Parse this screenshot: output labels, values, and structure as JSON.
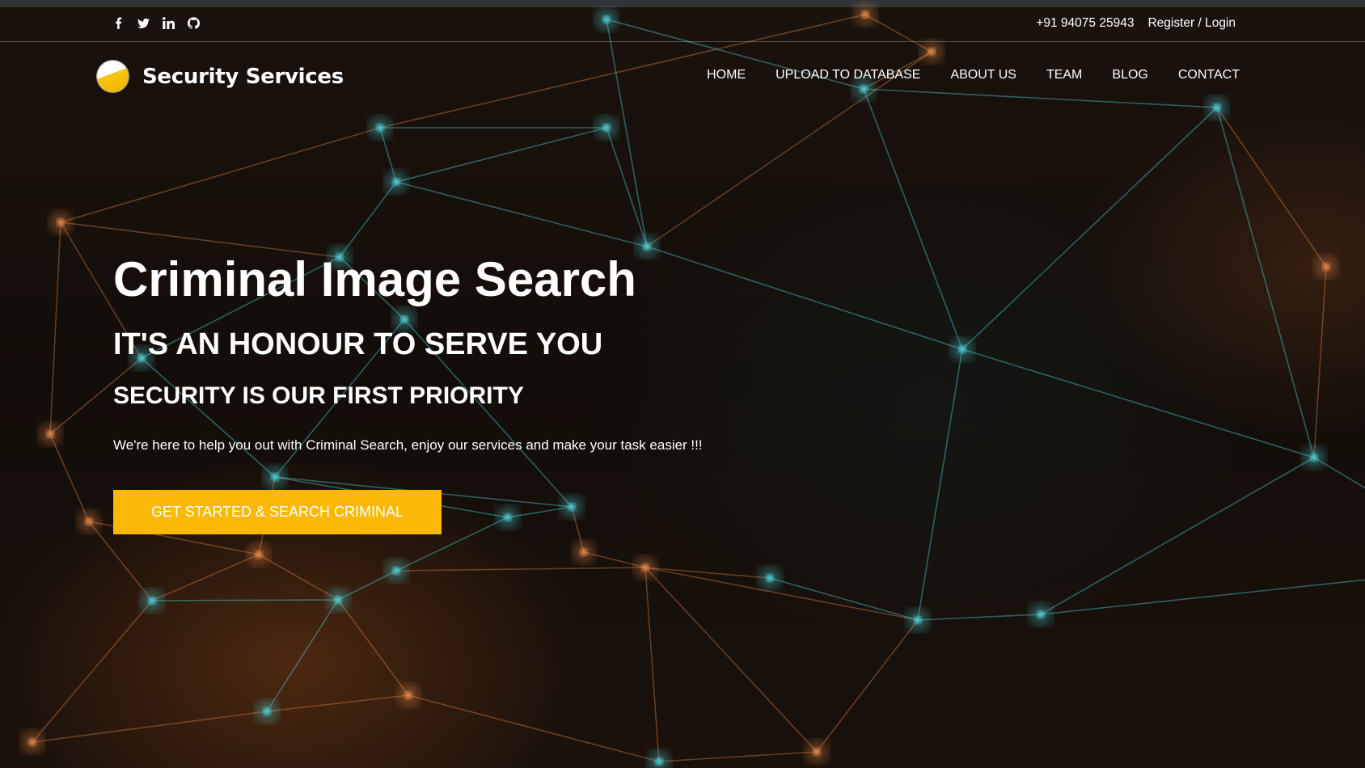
{
  "topbar": {
    "social_icons": [
      "facebook-icon",
      "twitter-icon",
      "linkedin-icon",
      "github-icon"
    ],
    "phone": "+91 94075 25943",
    "auth_link": "Register / Login"
  },
  "brand": {
    "name": "Security Services",
    "logo_colors": {
      "top": "#ffffff",
      "bottom": "#f0b500"
    }
  },
  "nav": {
    "items": [
      "HOME",
      "UPLOAD TO DATABASE",
      "ABOUT US",
      "TEAM",
      "BLOG",
      "CONTACT"
    ]
  },
  "hero": {
    "title": "Criminal Image Search",
    "subtitle": "IT'S AN HONOUR TO SERVE YOU",
    "tagline": "SECURITY IS OUR FIRST PRIORITY",
    "description": "We're here to help you out with Criminal Search, enjoy our services and make your task easier !!!",
    "cta_label": "GET STARTED & SEARCH CRIMINAL"
  },
  "colors": {
    "accent": "#fbb808",
    "background": "#130d09",
    "network_teal": "#4fd1d9",
    "network_orange": "#e8894a"
  }
}
